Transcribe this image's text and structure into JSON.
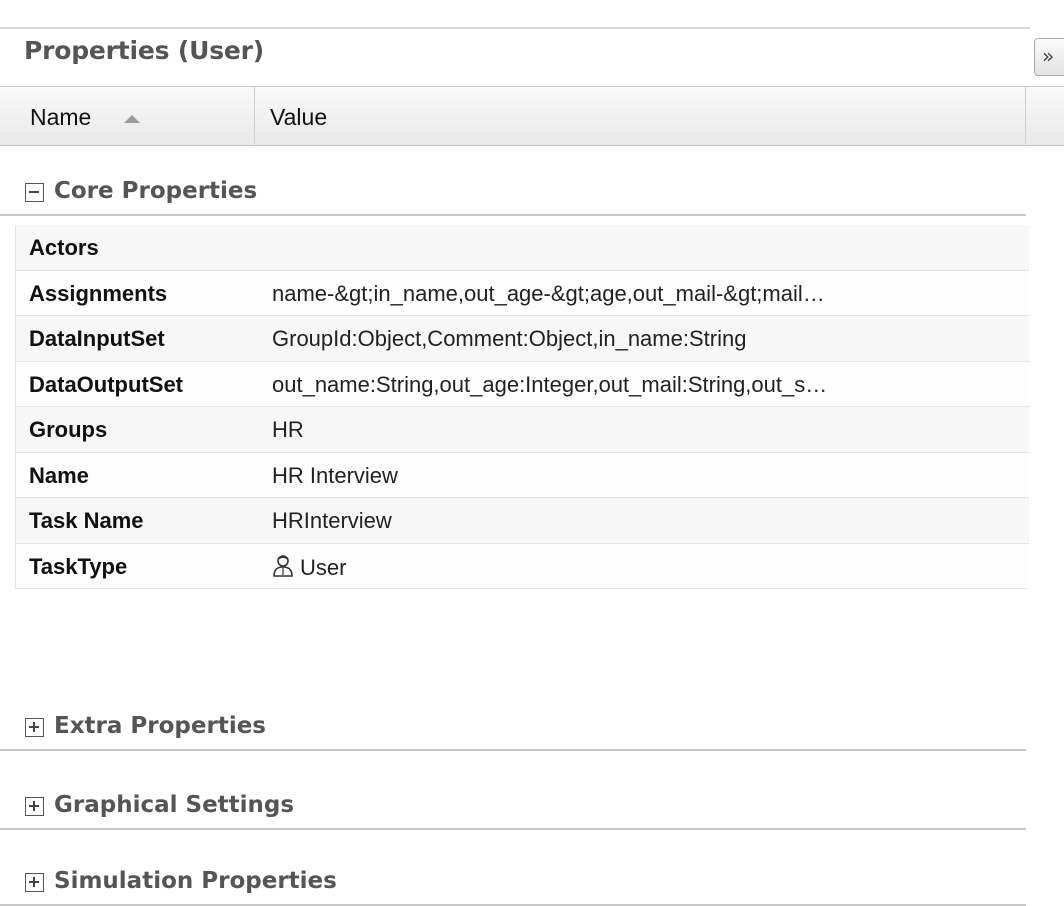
{
  "panel": {
    "title": "Properties (User)",
    "collapse_glyph": "»",
    "collapse_icon": "double-chevron-right-icon"
  },
  "columns": {
    "name_label": "Name",
    "name_sort_icon": "sort-ascending-icon",
    "value_label": "Value"
  },
  "groups": {
    "core": {
      "label": "Core Properties",
      "expanded": true,
      "toggle_icon": "collapse-minus-icon"
    },
    "extra": {
      "label": "Extra Properties",
      "expanded": false,
      "toggle_icon": "expand-plus-icon"
    },
    "graphical": {
      "label": "Graphical Settings",
      "expanded": false,
      "toggle_icon": "expand-plus-icon"
    },
    "simulation": {
      "label": "Simulation Properties",
      "expanded": false,
      "toggle_icon": "expand-plus-icon"
    }
  },
  "properties": [
    {
      "name": "Actors",
      "value": ""
    },
    {
      "name": "Assignments",
      "value": "name-&gt;in_name,out_age-&gt;age,out_mail-&gt;mail…"
    },
    {
      "name": "DataInputSet",
      "value": "GroupId:Object,Comment:Object,in_name:String"
    },
    {
      "name": "DataOutputSet",
      "value": "out_name:String,out_age:Integer,out_mail:String,out_s…"
    },
    {
      "name": "Groups",
      "value": "HR"
    },
    {
      "name": "Name",
      "value": "HR Interview"
    },
    {
      "name": "Task Name",
      "value": "HRInterview"
    },
    {
      "name": "TaskType",
      "value": "User",
      "icon": "user-icon"
    }
  ],
  "colors": {
    "group_label": "#555555",
    "header_bg": "#eeeeee",
    "row_bg": "#f7f7f7",
    "border": "#d0d0d0"
  }
}
